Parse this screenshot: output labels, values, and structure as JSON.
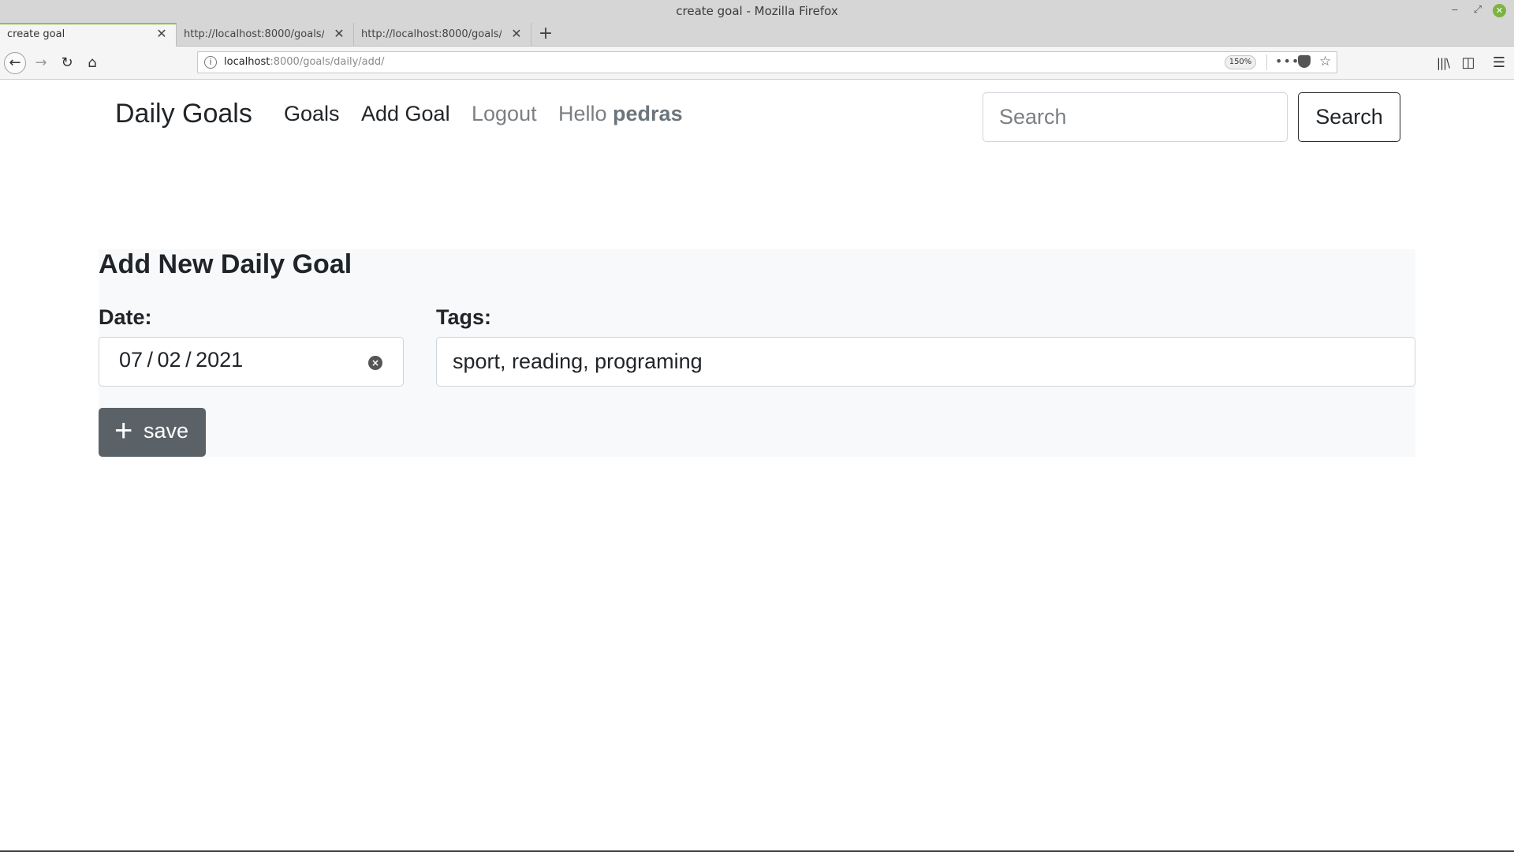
{
  "window": {
    "title": "create goal - Mozilla Firefox",
    "minimize_glyph": "‒",
    "maximize_glyph": "⤢",
    "close_glyph": "✕"
  },
  "tabs": [
    {
      "label": "create goal",
      "active": true
    },
    {
      "label": "http://localhost:8000/goals/daily/",
      "active": false
    },
    {
      "label": "http://localhost:8000/goals/daily/",
      "active": false
    }
  ],
  "tab_close_glyph": "✕",
  "new_tab_glyph": "+",
  "toolbar": {
    "back_glyph": "←",
    "forward_glyph": "→",
    "reload_glyph": "↻",
    "home_glyph": "⌂",
    "url_info_glyph": "i",
    "url_host": "localhost",
    "url_path": ":8000/goals/daily/add/",
    "zoom": "150%",
    "more_glyph": "•••",
    "star_glyph": "☆",
    "library_glyph": "|||\\",
    "sidebar_glyph": "◫",
    "menu_glyph": "☰"
  },
  "site": {
    "brand": "Daily Goals",
    "nav": {
      "goals": "Goals",
      "add_goal": "Add Goal",
      "logout": "Logout",
      "hello": "Hello",
      "username": "pedras"
    },
    "search": {
      "placeholder": "Search",
      "button": "Search"
    }
  },
  "form": {
    "heading": "Add New Daily Goal",
    "date_label": "Date:",
    "date_value": "07 / 02 / 2021",
    "date_clear_glyph": "×",
    "tags_label": "Tags:",
    "tags_value": "sport, reading, programing",
    "save_plus": "+",
    "save_label": "save"
  },
  "colors": {
    "save_button": "#5a6268",
    "panel_background": "#f8f9fa",
    "active_tab_accent": "#8bc34a"
  }
}
